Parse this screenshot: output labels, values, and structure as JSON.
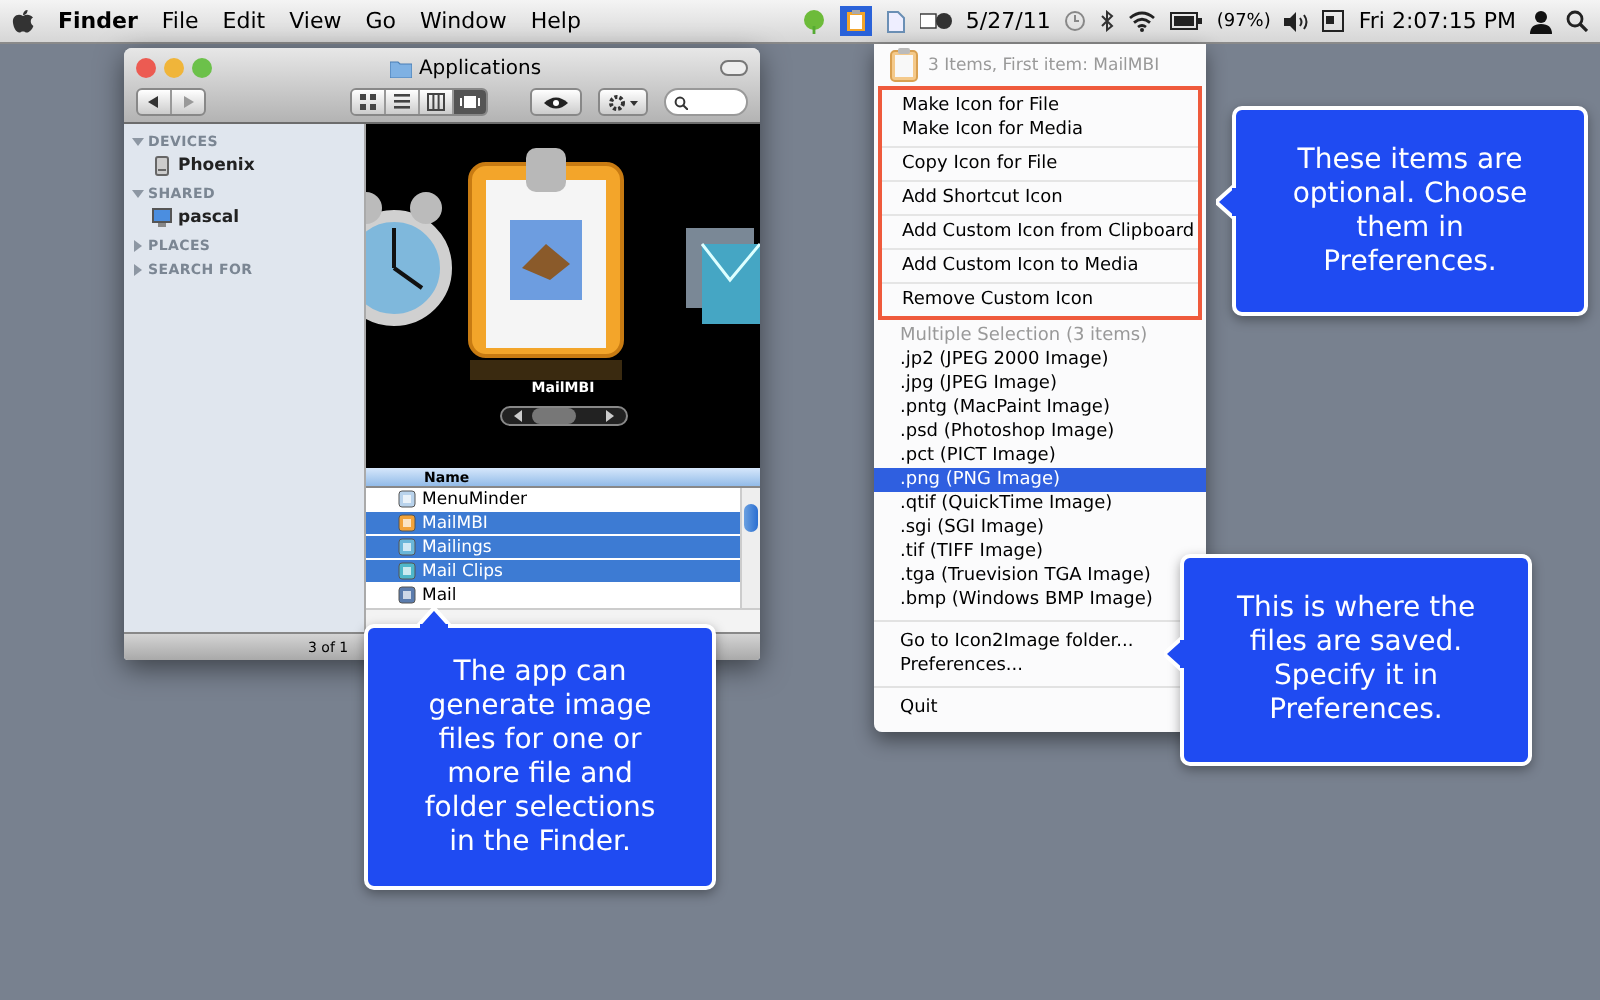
{
  "menubar": {
    "app": "Finder",
    "menus": [
      "File",
      "Edit",
      "View",
      "Go",
      "Window",
      "Help"
    ],
    "date": "5/27/11",
    "battery": "(97%)",
    "clock": "Fri 2:07:15 PM"
  },
  "finder": {
    "title": "Applications",
    "view_buttons": [
      {
        "kind": "icons",
        "selected": false
      },
      {
        "kind": "list",
        "selected": false
      },
      {
        "kind": "columns",
        "selected": false
      },
      {
        "kind": "coverflow",
        "selected": true
      }
    ],
    "sidebar": [
      {
        "label": "DEVICES",
        "expanded": true,
        "items": [
          {
            "label": "Phoenix",
            "kind": "disk"
          }
        ]
      },
      {
        "label": "SHARED",
        "expanded": true,
        "items": [
          {
            "label": "pascal",
            "kind": "computer"
          }
        ]
      },
      {
        "label": "PLACES",
        "expanded": false
      },
      {
        "label": "SEARCH FOR",
        "expanded": false
      }
    ],
    "caption": "MailMBI",
    "column": "Name",
    "rows": [
      {
        "name": "MenuMinder",
        "selected": false
      },
      {
        "name": "MailMBI",
        "selected": true
      },
      {
        "name": "Mailings",
        "selected": true
      },
      {
        "name": "Mail Clips",
        "selected": true
      },
      {
        "name": "Mail",
        "selected": false
      }
    ],
    "status": "3 of 1"
  },
  "menu": {
    "header": "3 Items, First item: MailMBI",
    "optional_groups": [
      [
        "Make Icon for File",
        "Make Icon for Media"
      ],
      [
        "Copy Icon for File"
      ],
      [
        "Add Shortcut Icon"
      ],
      [
        "Add Custom Icon from Clipboard"
      ],
      [
        "Add Custom Icon to Media"
      ],
      [
        "Remove Custom Icon"
      ]
    ],
    "selection_heading": "Multiple Selection (3 items)",
    "formats": [
      {
        "label": ".jp2 (JPEG 2000 Image)",
        "selected": false
      },
      {
        "label": ".jpg (JPEG Image)",
        "selected": false
      },
      {
        "label": ".pntg (MacPaint Image)",
        "selected": false
      },
      {
        "label": ".psd (Photoshop Image)",
        "selected": false
      },
      {
        "label": ".pct (PICT Image)",
        "selected": false
      },
      {
        "label": ".png (PNG Image)",
        "selected": true
      },
      {
        "label": ".qtif (QuickTime Image)",
        "selected": false
      },
      {
        "label": ".sgi (SGI Image)",
        "selected": false
      },
      {
        "label": ".tif (TIFF Image)",
        "selected": false
      },
      {
        "label": ".tga (Truevision TGA Image)",
        "selected": false
      },
      {
        "label": ".bmp (Windows BMP Image)",
        "selected": false
      }
    ],
    "folder_items": [
      "Go to Icon2Image folder...",
      "Preferences..."
    ],
    "quit": "Quit"
  },
  "callouts": [
    {
      "text": "The app can generate image files for one or more file and folder selections in the Finder.",
      "kind": "below"
    },
    {
      "text": "These items are optional. Choose them in Preferences.",
      "kind": "beside"
    },
    {
      "text": "This is where the files are saved. Specify it in Preferences.",
      "kind": "beside"
    }
  ]
}
